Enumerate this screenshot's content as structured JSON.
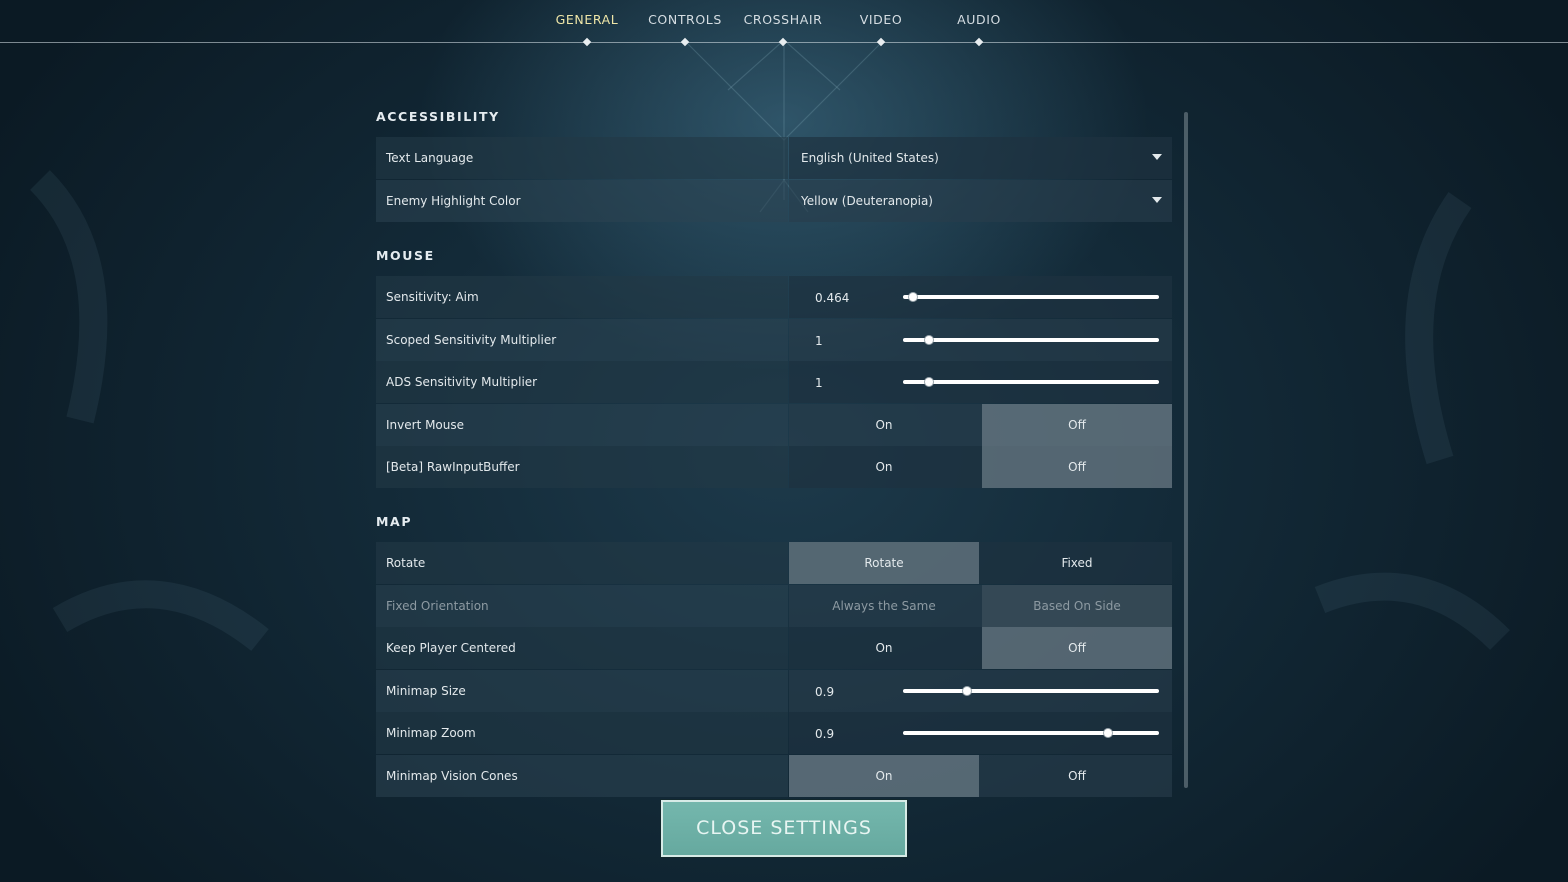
{
  "nav": {
    "tabs": [
      {
        "label": "GENERAL",
        "active": true
      },
      {
        "label": "CONTROLS",
        "active": false
      },
      {
        "label": "CROSSHAIR",
        "active": false
      },
      {
        "label": "VIDEO",
        "active": false
      },
      {
        "label": "AUDIO",
        "active": false
      }
    ]
  },
  "accessibility": {
    "title": "ACCESSIBILITY",
    "text_language": {
      "label": "Text Language",
      "value": "English (United States)"
    },
    "enemy_highlight": {
      "label": "Enemy Highlight Color",
      "value": "Yellow (Deuteranopia)"
    }
  },
  "mouse": {
    "title": "MOUSE",
    "sens_aim": {
      "label": "Sensitivity: Aim",
      "value": "0.464",
      "fill": 0.04
    },
    "scoped_sens": {
      "label": "Scoped Sensitivity Multiplier",
      "value": "1",
      "fill": 0.1
    },
    "ads_sens": {
      "label": "ADS Sensitivity Multiplier",
      "value": "1",
      "fill": 0.1
    },
    "invert_mouse": {
      "label": "Invert Mouse",
      "on": "On",
      "off": "Off",
      "selected": "Off"
    },
    "raw_input": {
      "label": "[Beta] RawInputBuffer",
      "on": "On",
      "off": "Off",
      "selected": "Off"
    }
  },
  "map": {
    "title": "MAP",
    "rotate": {
      "label": "Rotate",
      "opt1": "Rotate",
      "opt2": "Fixed",
      "selected": "Rotate"
    },
    "fixed_orientation": {
      "label": "Fixed Orientation",
      "opt1": "Always the Same",
      "opt2": "Based On Side",
      "selected": "Based On Side",
      "disabled": true
    },
    "keep_centered": {
      "label": "Keep Player Centered",
      "on": "On",
      "off": "Off",
      "selected": "Off"
    },
    "minimap_size": {
      "label": "Minimap Size",
      "value": "0.9",
      "fill": 0.25
    },
    "minimap_zoom": {
      "label": "Minimap Zoom",
      "value": "0.9",
      "fill": 0.8
    },
    "vision_cones": {
      "label": "Minimap Vision Cones",
      "on": "On",
      "off": "Off",
      "selected": "On"
    }
  },
  "close_button": {
    "label": "CLOSE SETTINGS",
    "color": "#66a99f"
  }
}
